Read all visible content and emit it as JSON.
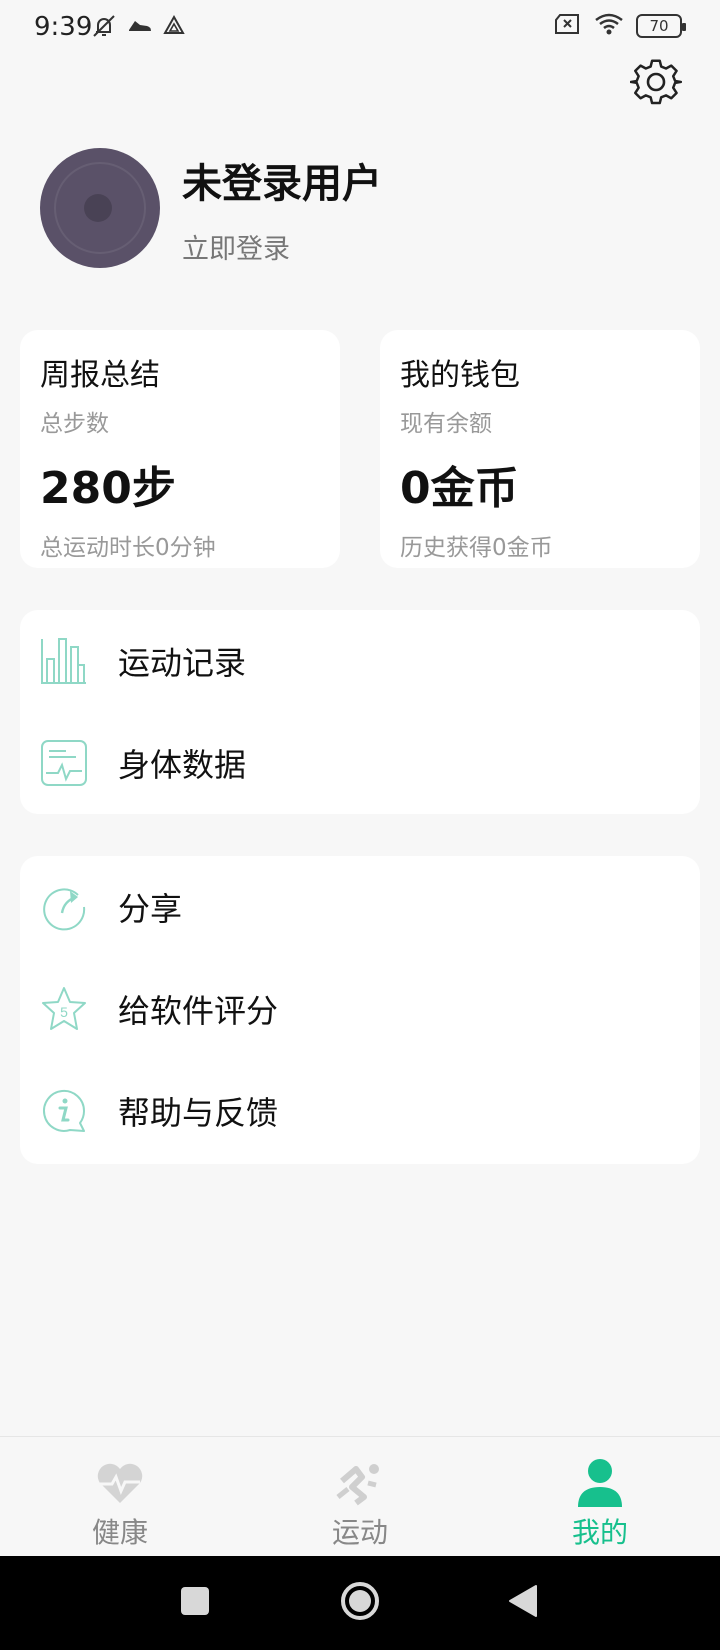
{
  "status_bar": {
    "time": "9:39",
    "battery": "70"
  },
  "profile": {
    "name": "未登录用户",
    "login_link": "立即登录"
  },
  "cards": {
    "weekly": {
      "title": "周报总结",
      "subtitle": "总步数",
      "value": "280步",
      "footer": "总运动时长0分钟"
    },
    "wallet": {
      "title": "我的钱包",
      "subtitle": "现有余额",
      "value": "0金币",
      "footer": "历史获得0金币"
    }
  },
  "menu_group_1": [
    {
      "label": "运动记录",
      "icon": "bar-chart-icon"
    },
    {
      "label": "身体数据",
      "icon": "body-data-icon"
    }
  ],
  "menu_group_2": [
    {
      "label": "分享",
      "icon": "share-icon"
    },
    {
      "label": "给软件评分",
      "icon": "star-rating-icon",
      "icon_text": "5"
    },
    {
      "label": "帮助与反馈",
      "icon": "help-info-icon"
    }
  ],
  "bottom_nav": [
    {
      "label": "健康",
      "icon": "heart-pulse-icon",
      "active": false
    },
    {
      "label": "运动",
      "icon": "running-icon",
      "active": false
    },
    {
      "label": "我的",
      "icon": "person-icon",
      "active": true
    }
  ],
  "colors": {
    "accent": "#17c08d",
    "icon_teal": "#8fd8c6",
    "inactive": "#888888",
    "avatar": "#5a5168"
  }
}
